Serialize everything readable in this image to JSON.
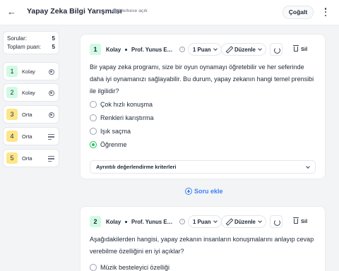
{
  "header": {
    "title": "Yapay Zeka Bilgi Yarışması",
    "visibility": "Herkese açık",
    "copy_label": "Çoğalt"
  },
  "sidebar": {
    "questions_label": "Sorular:",
    "questions_count": "5",
    "total_points_label": "Toplam puan:",
    "total_points": "5",
    "items": [
      {
        "number": "1",
        "level": "Kolay",
        "icon": "radio-icon"
      },
      {
        "number": "2",
        "level": "Kolay",
        "icon": "radio-icon"
      },
      {
        "number": "3",
        "level": "Orta",
        "icon": "radio-icon"
      },
      {
        "number": "4",
        "level": "Orta",
        "icon": "lines-icon"
      },
      {
        "number": "5",
        "level": "Orta",
        "icon": "lines-icon"
      }
    ]
  },
  "questions": [
    {
      "number": "1",
      "level": "Kolay",
      "author": "Prof. Yunus Emre",
      "points": "1 Puan",
      "edit_label": "Düzenle",
      "delete_label": "Sil",
      "text": "Bir yapay zeka programı, size bir oyun oynamayı öğretebilir ve her seferinde daha iyi oynamanızı sağlayabilir. Bu durum, yapay zekanın hangi temel prensibi ile ilgilidir?",
      "options": [
        "Çok hızlı konuşma",
        "Renkleri karıştırma",
        "Işık saçma",
        "Öğrenme"
      ],
      "selected_index": 3,
      "criteria_label": "Ayrıntılı değerlendirme kriterleri"
    },
    {
      "number": "2",
      "level": "Kolay",
      "author": "Prof. Yunus Emre",
      "points": "1 Puan",
      "edit_label": "Düzenle",
      "delete_label": "Sil",
      "text": "Aşağıdakilerden hangisi, yapay zekanın insanların konuşmalarını anlayıp cevap verebilme özelliğini en iyi açıklar?",
      "options": [
        "Müzik besteleyici özelliği"
      ]
    }
  ],
  "add_question_label": "Soru ekle",
  "colors": {
    "easy": "#d1fae5",
    "medium": "#fde68a",
    "accent": "#3b82f6",
    "selected": "#22c55e"
  }
}
